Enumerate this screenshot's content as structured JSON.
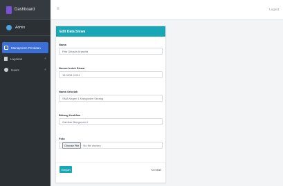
{
  "app": {
    "brand": "Dashboard"
  },
  "user": {
    "name": "Admin"
  },
  "sidebar": {
    "items": [
      {
        "label": "Manajemen Pendaan",
        "icon": "monitor-icon"
      },
      {
        "label": "Layanan",
        "icon": "document-icon"
      },
      {
        "label": "Users",
        "icon": "circle-icon"
      }
    ]
  },
  "topbar": {
    "menu_icon": "≡",
    "logout": "Logout"
  },
  "form": {
    "title": "Edit Data Siswa",
    "fields": [
      {
        "label": "Nama",
        "value": "Rita Oktavia Anjanita"
      },
      {
        "label": "Nomor Induk Siswa",
        "value": "18.0034.0.001"
      },
      {
        "label": "Nama Sekolah",
        "value": "SMA Negeri 1 Kabupaten Serang"
      },
      {
        "label": "Bidang Keahlian",
        "value": "Gambar Bangunan 4"
      },
      {
        "label": "Foto",
        "button": "Choose File",
        "file_status": "No file chosen"
      }
    ],
    "submit": "Simpan",
    "back": "Kembali"
  },
  "colors": {
    "accent": "#19a7b8",
    "sidebar": "#2b3035",
    "active": "#3b6fd6"
  }
}
